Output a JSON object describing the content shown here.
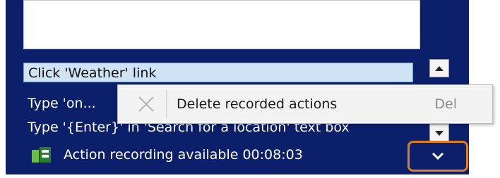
{
  "panel": {
    "list_items": [
      "Click 'Weather' link",
      "Type 'on...",
      "Type '{Enter}' in 'Search for a location' text box"
    ],
    "status_text": "Action recording available 00:08:03"
  },
  "context_menu": {
    "item_label": "Delete recorded actions",
    "shortcut": "Del"
  },
  "icons": {
    "scroll_up": "scroll-up-icon",
    "scroll_down": "scroll-down-icon",
    "recording": "action-recording-icon",
    "expand": "chevron-down-icon",
    "delete": "close-x-icon"
  },
  "colors": {
    "panel_bg": "#0b1f6b",
    "selection_bg": "#cfe3f5",
    "highlight_border": "#e07d1e"
  }
}
